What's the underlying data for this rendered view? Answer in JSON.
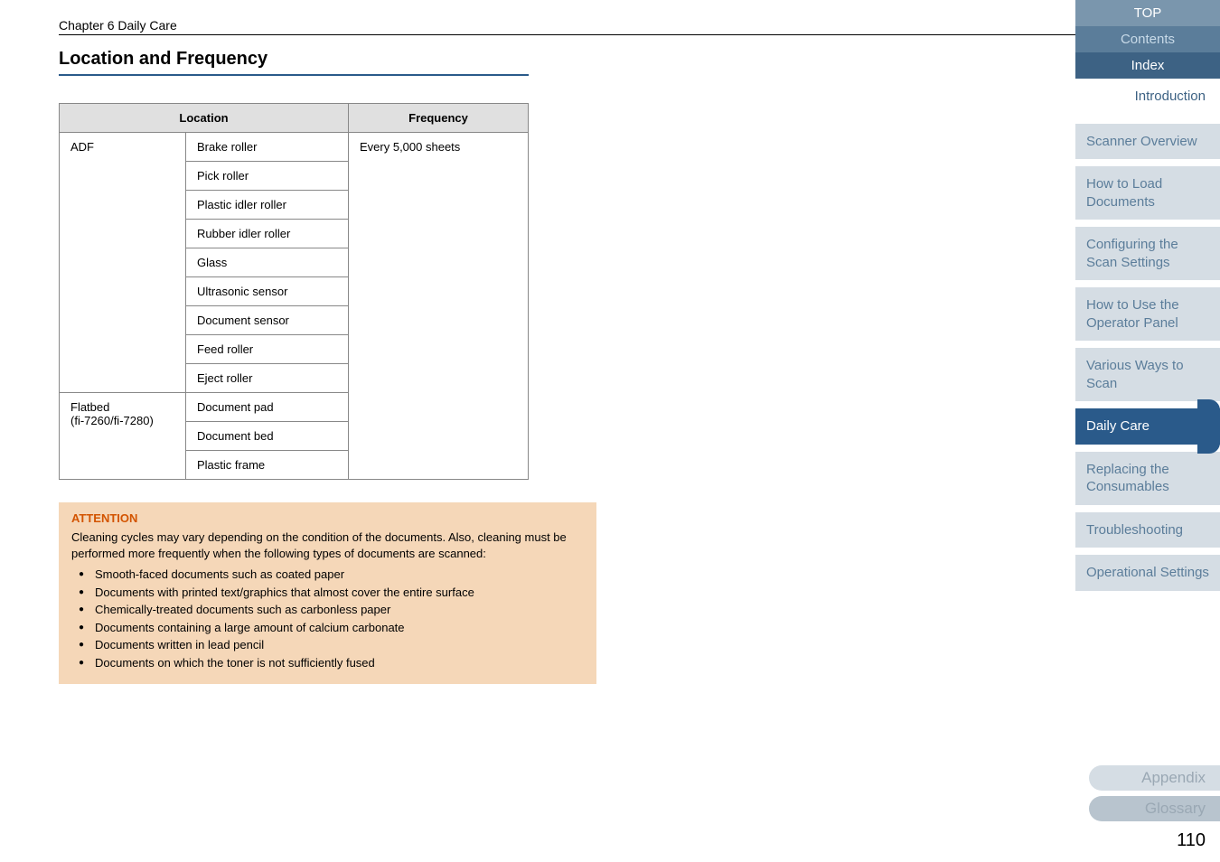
{
  "chapter": "Chapter 6 Daily Care",
  "section_title": "Location and Frequency",
  "table": {
    "headers": {
      "location": "Location",
      "frequency": "Frequency"
    },
    "rows": [
      {
        "loc": "ADF",
        "part": "Brake roller",
        "freq": "Every 5,000 sheets",
        "show_loc": true,
        "show_freq": true
      },
      {
        "loc": "",
        "part": "Pick roller",
        "freq": ""
      },
      {
        "loc": "",
        "part": "Plastic idler roller",
        "freq": ""
      },
      {
        "loc": "",
        "part": "Rubber idler roller",
        "freq": ""
      },
      {
        "loc": "",
        "part": "Glass",
        "freq": ""
      },
      {
        "loc": "",
        "part": "Ultrasonic sensor",
        "freq": ""
      },
      {
        "loc": "",
        "part": "Document sensor",
        "freq": ""
      },
      {
        "loc": "",
        "part": "Feed roller",
        "freq": ""
      },
      {
        "loc": "",
        "part": "Eject roller",
        "freq": ""
      },
      {
        "loc": "Flatbed\n(fi-7260/fi-7280)",
        "part": "Document pad",
        "freq": "",
        "show_loc": true
      },
      {
        "loc": "",
        "part": "Document bed",
        "freq": ""
      },
      {
        "loc": "",
        "part": "Plastic frame",
        "freq": ""
      }
    ]
  },
  "attention": {
    "title": "ATTENTION",
    "intro": "Cleaning cycles may vary depending on the condition of the documents. Also, cleaning must be performed more frequently when the following types of documents are scanned:",
    "items": [
      "Smooth-faced documents such as coated paper",
      "Documents with printed text/graphics that almost cover the entire surface",
      "Chemically-treated documents such as carbonless paper",
      "Documents containing a large amount of calcium carbonate",
      "Documents written in lead pencil",
      "Documents on which the toner is not sufficiently fused"
    ]
  },
  "nav": {
    "top": "TOP",
    "contents": "Contents",
    "index": "Index",
    "introduction": "Introduction",
    "sections": [
      "Scanner Overview",
      "How to Load Documents",
      "Configuring the Scan Settings",
      "How to Use the Operator Panel",
      "Various Ways to Scan",
      "Daily Care",
      "Replacing the Consumables",
      "Troubleshooting",
      "Operational Settings"
    ],
    "appendix": "Appendix",
    "glossary": "Glossary"
  },
  "page_number": "110"
}
